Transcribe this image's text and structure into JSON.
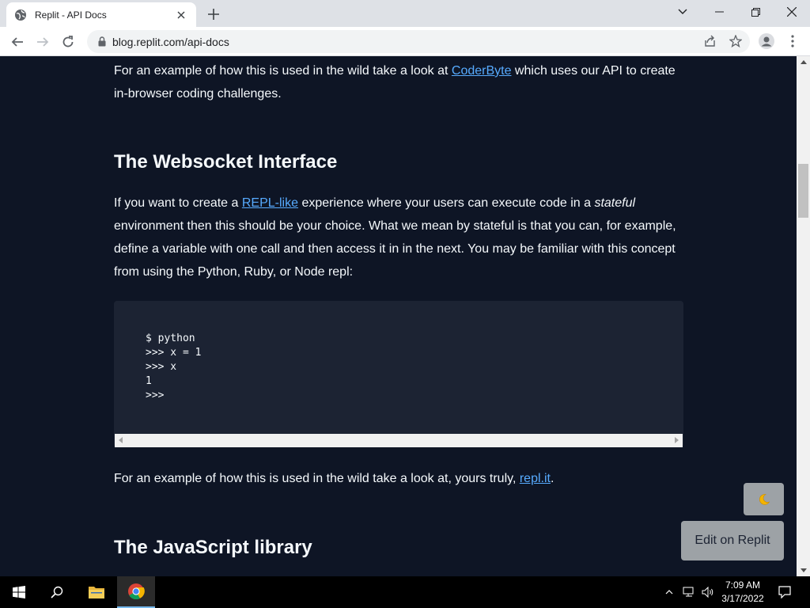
{
  "browser": {
    "tab": {
      "title": "Replit - API Docs",
      "favicon": "globe-icon",
      "close_icon": "close-icon"
    },
    "new_tab_icon": "plus-icon",
    "window_controls": [
      "chevron-down-icon",
      "minimize-icon",
      "restore-icon",
      "close-icon"
    ],
    "nav": {
      "back_icon": "arrow-left-icon",
      "forward_icon": "arrow-right-icon",
      "reload_icon": "reload-icon"
    },
    "address": {
      "lock_icon": "lock-icon",
      "url": "blog.replit.com/api-docs"
    },
    "toolbar_icons": [
      "share-icon",
      "star-icon",
      "profile-icon",
      "more-vert-icon"
    ]
  },
  "page": {
    "para1": {
      "before": "For an example of how this is used in the wild take a look at ",
      "link": "CoderByte",
      "after": " which uses our API to create in-browser coding challenges."
    },
    "heading1": "The Websocket Interface",
    "para2": {
      "before": "If you want to create a ",
      "link": "REPL-like",
      "middle": " experience where your users can execute code in a ",
      "emphasis": "stateful",
      "after": " environment then this should be your choice. What we mean by stateful is that you can, for example, define a variable with one call and then access it in in the next. You may be familiar with this concept from using the Python, Ruby, or Node repl:"
    },
    "code": "$ python\n>>> x = 1\n>>> x\n1\n>>>",
    "para3": {
      "before": "For an example of how this is used in the wild take a look at, yours truly, ",
      "link": "repl.it",
      "after": "."
    },
    "heading2": "The JavaScript library",
    "theme_toggle_icon": "moon-icon",
    "edit_button": "Edit on Replit"
  },
  "taskbar": {
    "icons": [
      "windows-start-icon",
      "search-icon",
      "file-explorer-icon",
      "chrome-icon"
    ],
    "tray_icons": [
      "chevron-up-icon",
      "network-icon",
      "volume-icon"
    ],
    "time": "7:09 AM",
    "date": "3/17/2022",
    "notification_icon": "notification-icon"
  },
  "colors": {
    "page_bg": "#0e1525",
    "code_bg": "#1c2333",
    "link": "#57abff",
    "text": "#f5f9fc",
    "floating_button_bg": "#9da2a6"
  }
}
